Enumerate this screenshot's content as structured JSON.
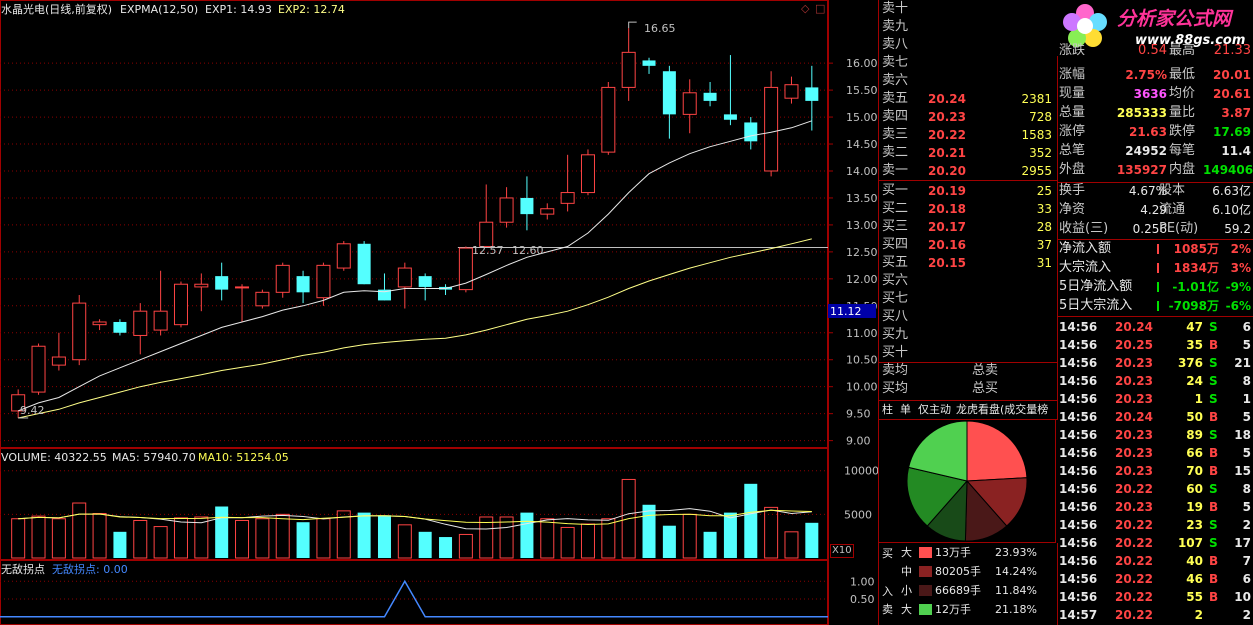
{
  "chart_header": {
    "title": "水晶光电(日线,前复权)",
    "indicator": "EXPMA(12,50)",
    "exp1": "EXP1: 14.93",
    "exp2": "EXP2: 12.74"
  },
  "volume_header": {
    "label": "VOLUME: 40322.55",
    "ma5": "MA5: 57940.70",
    "ma10": "MA10: 51254.05"
  },
  "sub_header": {
    "label": "无敌拐点",
    "value": "无敌拐点: 0.00"
  },
  "annotations": {
    "high": "16.65",
    "low": "9.42",
    "left_price": "12.57",
    "right_price": "12.60",
    "current_price": "11.12",
    "vol_unit": "X10"
  },
  "chart_data": [
    {
      "type": "candlestick",
      "y_ticks": [
        "16.00",
        "15.50",
        "15.00",
        "14.50",
        "14.00",
        "13.50",
        "13.00",
        "12.50",
        "12.00",
        "11.50",
        "11.00",
        "10.50",
        "10.00",
        "9.50",
        "9.00"
      ],
      "ylim": [
        8.9,
        16.8
      ],
      "candles": [
        {
          "o": 9.55,
          "h": 9.95,
          "l": 9.42,
          "c": 9.85
        },
        {
          "o": 9.9,
          "h": 10.8,
          "l": 9.85,
          "c": 10.75
        },
        {
          "o": 10.4,
          "h": 11.0,
          "l": 10.3,
          "c": 10.55
        },
        {
          "o": 10.5,
          "h": 11.7,
          "l": 10.4,
          "c": 11.55
        },
        {
          "o": 11.15,
          "h": 11.25,
          "l": 11.05,
          "c": 11.2
        },
        {
          "o": 11.2,
          "h": 11.25,
          "l": 10.95,
          "c": 11.0
        },
        {
          "o": 10.95,
          "h": 11.55,
          "l": 10.6,
          "c": 11.4
        },
        {
          "o": 11.05,
          "h": 12.15,
          "l": 10.95,
          "c": 11.4
        },
        {
          "o": 11.15,
          "h": 11.95,
          "l": 11.1,
          "c": 11.9
        },
        {
          "o": 11.85,
          "h": 12.1,
          "l": 11.4,
          "c": 11.9
        },
        {
          "o": 12.05,
          "h": 12.3,
          "l": 11.6,
          "c": 11.8
        },
        {
          "o": 11.85,
          "h": 11.9,
          "l": 11.2,
          "c": 11.85
        },
        {
          "o": 11.5,
          "h": 11.8,
          "l": 11.45,
          "c": 11.75
        },
        {
          "o": 11.75,
          "h": 12.3,
          "l": 11.65,
          "c": 12.25
        },
        {
          "o": 12.05,
          "h": 12.15,
          "l": 11.55,
          "c": 11.75
        },
        {
          "o": 11.65,
          "h": 12.3,
          "l": 11.5,
          "c": 12.25
        },
        {
          "o": 12.2,
          "h": 12.7,
          "l": 12.15,
          "c": 12.65
        },
        {
          "o": 12.65,
          "h": 12.7,
          "l": 11.9,
          "c": 11.9
        },
        {
          "o": 11.8,
          "h": 12.1,
          "l": 11.6,
          "c": 11.6
        },
        {
          "o": 11.85,
          "h": 12.3,
          "l": 11.45,
          "c": 12.2
        },
        {
          "o": 12.05,
          "h": 12.1,
          "l": 11.6,
          "c": 11.85
        },
        {
          "o": 11.85,
          "h": 11.9,
          "l": 11.7,
          "c": 11.8
        },
        {
          "o": 11.8,
          "h": 12.6,
          "l": 11.75,
          "c": 12.57
        },
        {
          "o": 12.6,
          "h": 13.75,
          "l": 12.6,
          "c": 13.05
        },
        {
          "o": 13.05,
          "h": 13.7,
          "l": 12.95,
          "c": 13.5
        },
        {
          "o": 13.5,
          "h": 13.9,
          "l": 12.9,
          "c": 13.2
        },
        {
          "o": 13.2,
          "h": 13.4,
          "l": 13.1,
          "c": 13.3
        },
        {
          "o": 13.4,
          "h": 14.3,
          "l": 13.25,
          "c": 13.6
        },
        {
          "o": 13.6,
          "h": 14.4,
          "l": 13.55,
          "c": 14.3
        },
        {
          "o": 14.35,
          "h": 15.65,
          "l": 14.3,
          "c": 15.55
        },
        {
          "o": 15.55,
          "h": 16.65,
          "l": 15.3,
          "c": 16.2
        },
        {
          "o": 16.05,
          "h": 16.1,
          "l": 15.8,
          "c": 15.95
        },
        {
          "o": 15.85,
          "h": 15.95,
          "l": 14.6,
          "c": 15.05
        },
        {
          "o": 15.05,
          "h": 15.7,
          "l": 14.7,
          "c": 15.45
        },
        {
          "o": 15.45,
          "h": 15.65,
          "l": 15.2,
          "c": 15.3
        },
        {
          "o": 15.05,
          "h": 16.15,
          "l": 14.85,
          "c": 14.95
        },
        {
          "o": 14.9,
          "h": 15.0,
          "l": 14.4,
          "c": 14.55
        },
        {
          "o": 14.0,
          "h": 15.85,
          "l": 13.9,
          "c": 15.55
        },
        {
          "o": 15.35,
          "h": 15.75,
          "l": 15.25,
          "c": 15.6
        },
        {
          "o": 15.55,
          "h": 15.95,
          "l": 14.75,
          "c": 15.3
        }
      ],
      "exp1": [
        9.55,
        9.7,
        9.8,
        10.0,
        10.2,
        10.35,
        10.5,
        10.65,
        10.8,
        10.95,
        11.1,
        11.2,
        11.3,
        11.42,
        11.5,
        11.6,
        11.75,
        11.78,
        11.76,
        11.82,
        11.82,
        11.82,
        11.92,
        12.08,
        12.25,
        12.4,
        12.5,
        12.6,
        12.85,
        13.2,
        13.6,
        13.95,
        14.15,
        14.32,
        14.45,
        14.55,
        14.65,
        14.72,
        14.8,
        14.93
      ],
      "exp2": [
        9.42,
        9.5,
        9.58,
        9.7,
        9.8,
        9.9,
        10.0,
        10.08,
        10.15,
        10.22,
        10.3,
        10.36,
        10.42,
        10.5,
        10.58,
        10.64,
        10.72,
        10.78,
        10.82,
        10.85,
        10.88,
        10.9,
        10.96,
        11.05,
        11.15,
        11.25,
        11.32,
        11.4,
        11.52,
        11.66,
        11.82,
        11.96,
        12.08,
        12.2,
        12.3,
        12.4,
        12.48,
        12.56,
        12.65,
        12.74
      ]
    },
    {
      "type": "bar",
      "y_ticks": [
        "10000",
        "5000"
      ],
      "ylim": [
        0,
        11000
      ],
      "values": [
        4500,
        4800,
        4500,
        6300,
        5100,
        3000,
        4300,
        3600,
        4600,
        4700,
        5900,
        4300,
        4500,
        5000,
        4100,
        4500,
        5400,
        5200,
        4900,
        3800,
        3000,
        2400,
        2700,
        4700,
        4700,
        5200,
        4500,
        3500,
        3900,
        4500,
        9000,
        6100,
        3700,
        5000,
        3000,
        5200,
        8500,
        5800,
        3000,
        4032
      ]
    },
    {
      "type": "line",
      "y_ticks": [
        "1.00",
        "0.50"
      ],
      "ylim": [
        -0.15,
        1.15
      ],
      "values": [
        0,
        0,
        0,
        0,
        0,
        0,
        0,
        0,
        0,
        0,
        0,
        0,
        0,
        0,
        0,
        0,
        0,
        0,
        0,
        1,
        0,
        0,
        0,
        0,
        0,
        0,
        0,
        0,
        0,
        0,
        0,
        0,
        0,
        0,
        0,
        0,
        0,
        0,
        0,
        0
      ]
    }
  ],
  "order_book": {
    "sell": [
      {
        "name": "卖十",
        "price": "",
        "vol": ""
      },
      {
        "name": "卖九",
        "price": "",
        "vol": ""
      },
      {
        "name": "卖八",
        "price": "",
        "vol": ""
      },
      {
        "name": "卖七",
        "price": "",
        "vol": ""
      },
      {
        "name": "卖六",
        "price": "",
        "vol": ""
      },
      {
        "name": "卖五",
        "price": "20.24",
        "vol": "2381"
      },
      {
        "name": "卖四",
        "price": "20.23",
        "vol": "728"
      },
      {
        "name": "卖三",
        "price": "20.22",
        "vol": "1583"
      },
      {
        "name": "卖二",
        "price": "20.21",
        "vol": "352"
      },
      {
        "name": "卖一",
        "price": "20.20",
        "vol": "2955"
      }
    ],
    "buy": [
      {
        "name": "买一",
        "price": "20.19",
        "vol": "25"
      },
      {
        "name": "买二",
        "price": "20.18",
        "vol": "33"
      },
      {
        "name": "买三",
        "price": "20.17",
        "vol": "28"
      },
      {
        "name": "买四",
        "price": "20.16",
        "vol": "37"
      },
      {
        "name": "买五",
        "price": "20.15",
        "vol": "31"
      },
      {
        "name": "买六",
        "price": "",
        "vol": ""
      },
      {
        "name": "买七",
        "price": "",
        "vol": ""
      },
      {
        "name": "买八",
        "price": "",
        "vol": ""
      },
      {
        "name": "买九",
        "price": "",
        "vol": ""
      },
      {
        "name": "买十",
        "price": "",
        "vol": ""
      }
    ],
    "sell_avg": "卖均",
    "buy_avg": "买均",
    "total_sell": "总卖",
    "total_buy": "总买"
  },
  "tabs": [
    "柱",
    "单",
    "仅主动",
    "龙虎看盘(成交量榜"
  ],
  "pie": {
    "slices": [
      {
        "pct": 23.93,
        "color": "#ff5050"
      },
      {
        "pct": 14.24,
        "color": "#8a2222"
      },
      {
        "pct": 11.84,
        "color": "#4a1818"
      },
      {
        "pct": 11.0,
        "color": "#184a18"
      },
      {
        "pct": 17.0,
        "color": "#238a23"
      },
      {
        "pct": 21.18,
        "color": "#50d050"
      }
    ]
  },
  "flow_table": {
    "buy_label_top": "买",
    "buy_label_bottom": "入",
    "sell_label": "卖",
    "rows": [
      {
        "size": "大",
        "vol": "13万手",
        "pct": "23.93%",
        "color": "#ff5050"
      },
      {
        "size": "中",
        "vol": "80205手",
        "pct": "14.24%",
        "color": "#8a2222"
      },
      {
        "size": "小",
        "vol": "66689手",
        "pct": "11.84%",
        "color": "#4a1818"
      },
      {
        "size": "大",
        "vol": "12万手",
        "pct": "21.18%",
        "color": "#50d050"
      }
    ]
  },
  "logo": {
    "text": "分析家公式网",
    "url": "www.88gs.com"
  },
  "stats": {
    "partial": [
      {
        "label": "涨跌",
        "value": "0.54",
        "label2": "最高",
        "value2": "21.33"
      }
    ],
    "rows": [
      {
        "label": "涨幅",
        "value": "2.75%",
        "vcolor": "#ff4444",
        "label2": "最低",
        "value2": "20.01",
        "v2color": "#ff4444"
      },
      {
        "label": "现量",
        "value": "3636",
        "vcolor": "#ff55ff",
        "label2": "均价",
        "value2": "20.61",
        "v2color": "#ff4444"
      },
      {
        "label": "总量",
        "value": "285333",
        "vcolor": "#ffff55",
        "label2": "量比",
        "value2": "3.87",
        "v2color": "#ff4444"
      },
      {
        "label": "涨停",
        "value": "21.63",
        "vcolor": "#ff4444",
        "label2": "跌停",
        "value2": "17.69",
        "v2color": "#00e000"
      },
      {
        "label": "总笔",
        "value": "24952",
        "vcolor": "#e8e8e8",
        "label2": "每笔",
        "value2": "11.4",
        "v2color": "#e8e8e8"
      },
      {
        "label": "外盘",
        "value": "135927",
        "vcolor": "#ff4444",
        "label2": "内盘",
        "value2": "149406",
        "v2color": "#00e000"
      }
    ],
    "rows2": [
      {
        "label": "换手",
        "value": "4.67%",
        "label2": "股本",
        "value2": "6.63亿"
      },
      {
        "label": "净资",
        "value": "4.29",
        "label2": "流通",
        "value2": "6.10亿"
      },
      {
        "label": "收益(三)",
        "value": "0.256",
        "label2": "PE(动)",
        "value2": "59.2"
      }
    ]
  },
  "fund_flow": [
    {
      "label": "净流入额",
      "value": "1085万",
      "pct": "2%",
      "color": "#ff4444"
    },
    {
      "label": "大宗流入",
      "value": "1834万",
      "pct": "3%",
      "color": "#ff4444"
    },
    {
      "label": "5日净流入额",
      "value": "-1.01亿",
      "pct": "-9%",
      "color": "#00e000"
    },
    {
      "label": "5日大宗流入",
      "value": "-7098万",
      "pct": "-6%",
      "color": "#00e000"
    }
  ],
  "ticks": [
    {
      "time": "14:56",
      "price": "20.24",
      "vol": "47",
      "side": "S",
      "num": "6"
    },
    {
      "time": "14:56",
      "price": "20.25",
      "vol": "35",
      "side": "B",
      "num": "5"
    },
    {
      "time": "14:56",
      "price": "20.23",
      "vol": "376",
      "side": "S",
      "num": "21"
    },
    {
      "time": "14:56",
      "price": "20.23",
      "vol": "24",
      "side": "S",
      "num": "8"
    },
    {
      "time": "14:56",
      "price": "20.23",
      "vol": "1",
      "side": "S",
      "num": "1"
    },
    {
      "time": "14:56",
      "price": "20.24",
      "vol": "50",
      "side": "B",
      "num": "5"
    },
    {
      "time": "14:56",
      "price": "20.23",
      "vol": "89",
      "side": "S",
      "num": "18"
    },
    {
      "time": "14:56",
      "price": "20.23",
      "vol": "66",
      "side": "B",
      "num": "5"
    },
    {
      "time": "14:56",
      "price": "20.23",
      "vol": "70",
      "side": "B",
      "num": "15"
    },
    {
      "time": "14:56",
      "price": "20.22",
      "vol": "60",
      "side": "S",
      "num": "8"
    },
    {
      "time": "14:56",
      "price": "20.23",
      "vol": "19",
      "side": "B",
      "num": "5"
    },
    {
      "time": "14:56",
      "price": "20.22",
      "vol": "23",
      "side": "S",
      "num": "2"
    },
    {
      "time": "14:56",
      "price": "20.22",
      "vol": "107",
      "side": "S",
      "num": "17"
    },
    {
      "time": "14:56",
      "price": "20.22",
      "vol": "40",
      "side": "B",
      "num": "7"
    },
    {
      "time": "14:56",
      "price": "20.22",
      "vol": "46",
      "side": "B",
      "num": "6"
    },
    {
      "time": "14:56",
      "price": "20.22",
      "vol": "55",
      "side": "B",
      "num": "10"
    },
    {
      "time": "14:57",
      "price": "20.22",
      "vol": "2",
      "side": "",
      "num": "2"
    }
  ],
  "colors": {
    "up": "#ff4444",
    "down": "#54ffff",
    "exp1": "#e8e8e8",
    "exp2": "#ffff88",
    "grid": "#8b0000",
    "border": "#a00000"
  }
}
